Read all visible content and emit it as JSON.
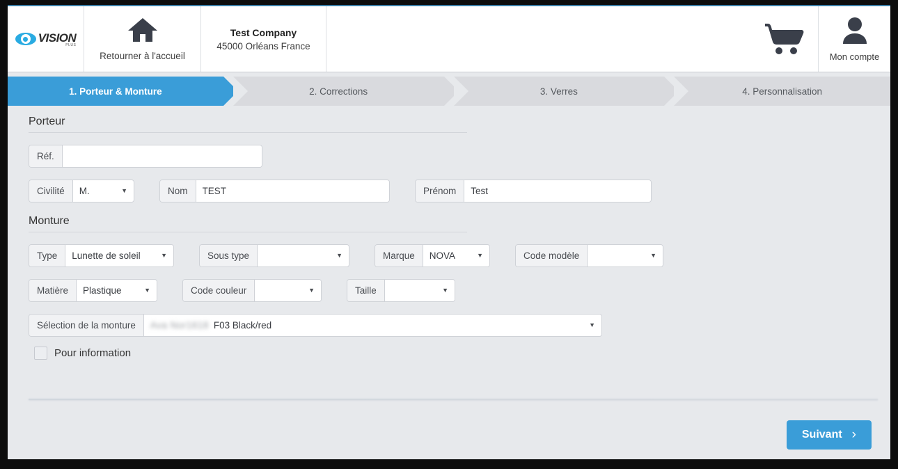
{
  "header": {
    "logo_text": "VISION",
    "logo_sub": "PLUS",
    "home_label": "Retourner à l'accueil",
    "company_name": "Test Company",
    "company_address": "45000 Orléans France",
    "account_label": "Mon compte"
  },
  "steps": [
    {
      "label": "1. Porteur & Monture",
      "active": true
    },
    {
      "label": "2. Corrections",
      "active": false
    },
    {
      "label": "3. Verres",
      "active": false
    },
    {
      "label": "4. Personnalisation",
      "active": false
    }
  ],
  "sections": {
    "porteur": {
      "title": "Porteur",
      "ref": {
        "label": "Réf.",
        "value": "",
        "placeholder": ""
      },
      "civilite": {
        "label": "Civilité",
        "value": "M."
      },
      "nom": {
        "label": "Nom",
        "value": "TEST",
        "placeholder": ""
      },
      "prenom": {
        "label": "Prénom",
        "value": "Test",
        "placeholder": ""
      }
    },
    "monture": {
      "title": "Monture",
      "type": {
        "label": "Type",
        "value": "Lunette de soleil"
      },
      "sous_type": {
        "label": "Sous type",
        "value": ""
      },
      "marque": {
        "label": "Marque",
        "value": "NOVA"
      },
      "code_modele": {
        "label": "Code modèle",
        "value": ""
      },
      "matiere": {
        "label": "Matière",
        "value": "Plastique"
      },
      "code_couleur": {
        "label": "Code couleur",
        "value": ""
      },
      "taille": {
        "label": "Taille",
        "value": ""
      },
      "selection": {
        "label": "Sélection de la monture",
        "redacted_prefix": "Ava Nor1618",
        "value": "F03 Black/red"
      },
      "pour_information": {
        "label": "Pour information",
        "checked": false
      }
    }
  },
  "footer": {
    "next_label": "Suivant",
    "next_chevron": "›"
  },
  "colors": {
    "accent_blue": "#3a9dd8",
    "header_border": "#3b7fa8",
    "page_bg": "#e7e9ec",
    "step_inactive": "#d9dade"
  }
}
